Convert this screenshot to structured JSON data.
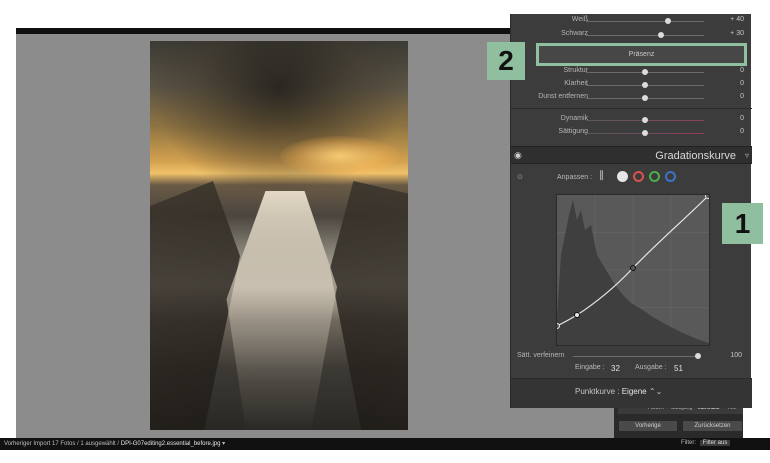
{
  "develop_panel": {
    "sliders_top": [
      {
        "label": "Weiß",
        "value": "+ 40",
        "knob_fraction": 0.7
      },
      {
        "label": "Schwarz",
        "value": "+ 30",
        "knob_fraction": 0.65
      }
    ],
    "praesenz_label": "Präsenz",
    "sliders_presence": [
      {
        "label": "Struktur",
        "value": "0",
        "knob_fraction": 0.5
      },
      {
        "label": "Klarheit",
        "value": "0",
        "knob_fraction": 0.5
      },
      {
        "label": "Dunst entfernen",
        "value": "0",
        "knob_fraction": 0.5
      },
      {
        "label": "Dynamik",
        "value": "0",
        "knob_fraction": 0.5
      },
      {
        "label": "Sättigung",
        "value": "0",
        "knob_fraction": 0.5
      }
    ]
  },
  "tone_curve": {
    "title": "Gradationskurve",
    "adjust_label": "Anpassen :",
    "channels": [
      "parametric",
      "point-rgb",
      "red",
      "green",
      "blue"
    ],
    "channel_colors": {
      "rgb": "#e6e6e6",
      "red": "#d9534f",
      "green": "#4cae4c",
      "blue": "#3b73c9"
    },
    "refine_label": "Sätt. verfeinern",
    "refine_value": "100",
    "input_label": "Eingabe :",
    "input_value": "32",
    "output_label": "Ausgabe :",
    "output_value": "51",
    "point_curve_label": "Punktkurve :",
    "point_curve_value": "Eigene",
    "chevrons": "⌃⌄"
  },
  "annotations": {
    "badge_1": "1",
    "badge_2": "2"
  },
  "status": {
    "prefix": "Vorheriger Import  17 Fotos / 1 ausgewählt /",
    "file": "DPI-G07editing2.essential_before.jpg",
    "arrow": "▾"
  },
  "bottom_right": {
    "tabs": [
      "Farben",
      "Sättigung",
      "Luminanz",
      "Alle"
    ],
    "active_tab": "Luminanz",
    "prev_button": "Vorherige",
    "reset_button": "Zurücksetzen",
    "filter_label": "Filter:",
    "filter_value": "Filter aus"
  }
}
